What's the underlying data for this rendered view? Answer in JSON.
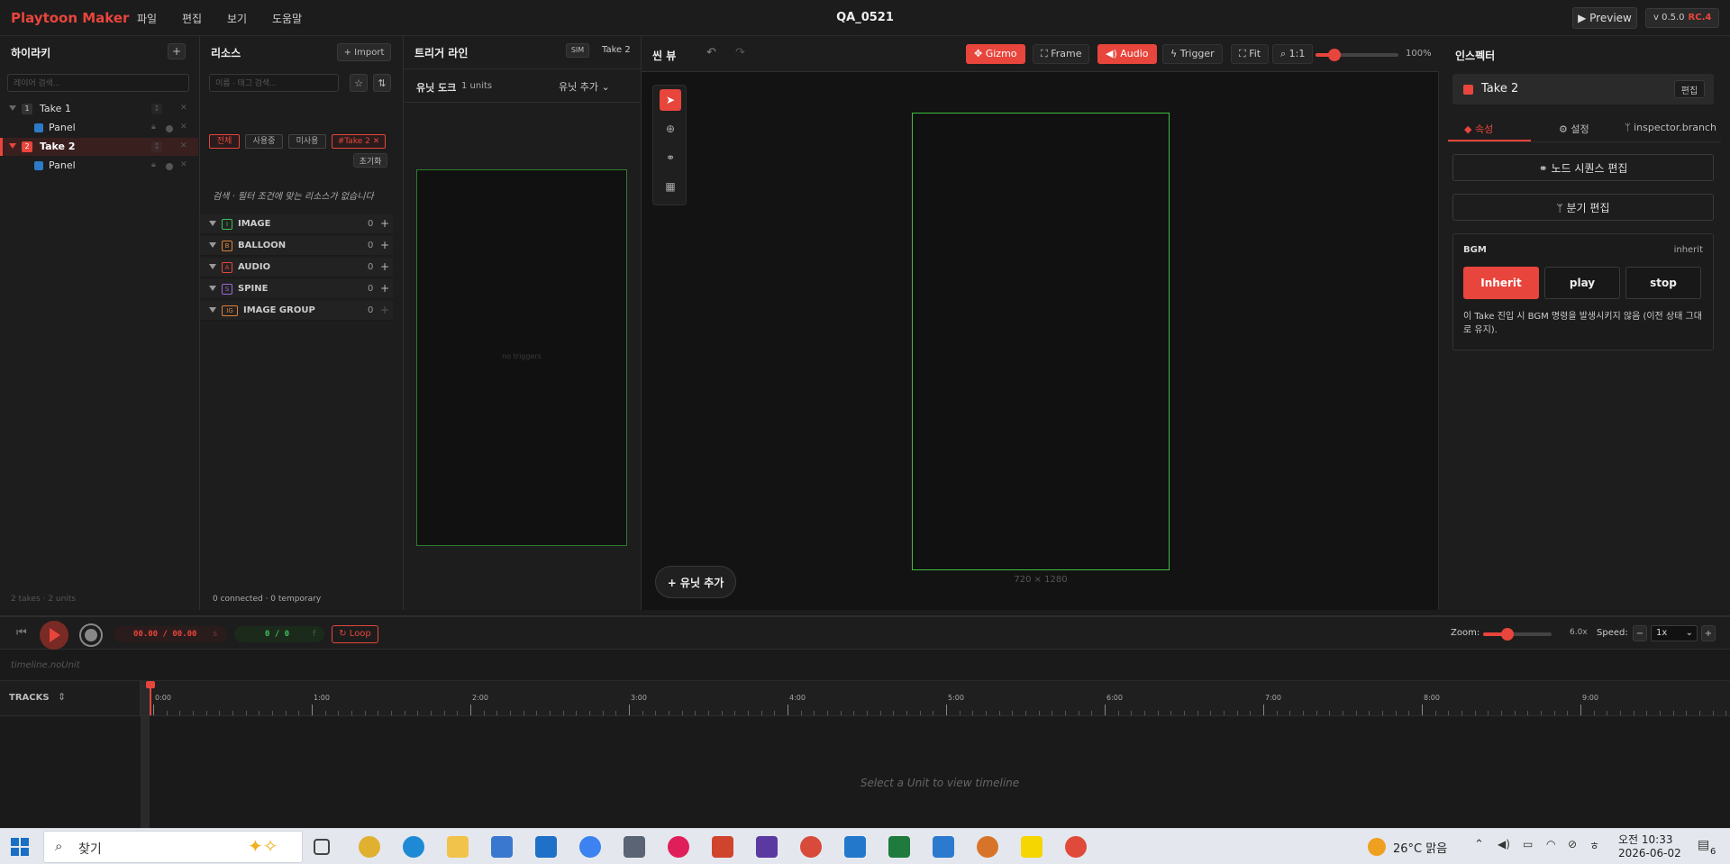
{
  "menubar": {
    "logo": "Playtoon Maker",
    "menus": [
      "파일",
      "편집",
      "보기",
      "도움말"
    ],
    "project_title": "QA_0521",
    "preview_label": "▶ Preview",
    "version": "v 0.5.0",
    "rc": "RC.4"
  },
  "hierarchy": {
    "title": "하이라키",
    "add_label": "+",
    "search_placeholder": "레이어 검색...",
    "takes": [
      {
        "num": "1",
        "label": "Take 1",
        "child": "Panel"
      },
      {
        "num": "2",
        "label": "Take 2",
        "child": "Panel"
      }
    ],
    "footer": "2 takes · 2 units"
  },
  "resources": {
    "title": "리소스",
    "import_label": "+ Import",
    "search_placeholder": "이름 · 태그 검색...",
    "chips": [
      "전체",
      "사용중",
      "미사용",
      "#Take 2 ✕"
    ],
    "reset_label": "초기화",
    "empty_msg": "검색 · 필터 조건에 맞는 리소스가 없습니다",
    "categories": [
      {
        "badge": "I",
        "name": "IMAGE",
        "count": "0",
        "color": "#3fbf5a"
      },
      {
        "badge": "B",
        "name": "BALLOON",
        "count": "0",
        "color": "#e0803a"
      },
      {
        "badge": "A",
        "name": "AUDIO",
        "count": "0",
        "color": "#e8453c"
      },
      {
        "badge": "S",
        "name": "SPINE",
        "count": "0",
        "color": "#9b6ad8"
      },
      {
        "badge": "IG",
        "name": "IMAGE GROUP",
        "count": "0",
        "color": "#e0803a"
      }
    ],
    "footer": "0 connected · 0 temporary"
  },
  "trigger": {
    "title": "트리거 라인",
    "sim_label": "SIM",
    "take_label": "Take 2",
    "dock_title": "유닛 도크",
    "dock_count": "1 units",
    "add_unit_label": "유닛 추가",
    "no_triggers": "no triggers"
  },
  "scene": {
    "title": "씬 뷰",
    "gizmo": "Gizmo",
    "frame": "Frame",
    "audio": "Audio",
    "trigger": "Trigger",
    "fit": "Fit",
    "ratio": "1:1",
    "zoom_pct": "100%",
    "zoom_value": 100,
    "canvas_size": "720 × 1280",
    "add_unit": "+ 유닛 추가"
  },
  "inspector": {
    "title": "인스펙터",
    "take_name": "Take 2",
    "edit_label": "편집",
    "tabs": [
      "속성",
      "설정",
      "inspector.branch"
    ],
    "node_seq_btn": "노드 시퀀스 편집",
    "branch_btn": "분기 편집",
    "bgm": {
      "label": "BGM",
      "value": "inherit",
      "options": [
        "Inherit",
        "play",
        "stop"
      ],
      "desc": "이 Take 진입 시 BGM 명령을 발생시키지 않음 (이전 상태 그대로 유지)."
    }
  },
  "timeline": {
    "time": "00.00 / 00.00",
    "time_unit": "s",
    "frames": "0 / 0",
    "frames_unit": "f",
    "loop": "Loop",
    "zoom_label": "Zoom:",
    "zoom_value": "6.0x",
    "speed_label": "Speed:",
    "speed_value": "1x",
    "no_unit": "timeline.noUnit",
    "tracks": "TRACKS",
    "ticks": [
      "0:00",
      "1:00",
      "2:00",
      "3:00",
      "4:00",
      "5:00",
      "6:00",
      "7:00",
      "8:00",
      "9:00"
    ],
    "empty_msg": "Select a Unit to view timeline"
  },
  "taskbar": {
    "search": "찾기",
    "weather": "26°C 맑음",
    "time": "오전 10:33",
    "date": "2026-06-02",
    "notif": "6"
  },
  "colors": {
    "accent": "#e8453c",
    "canvas_border": "#3fbf3f",
    "bg": "#1b1b1b"
  }
}
